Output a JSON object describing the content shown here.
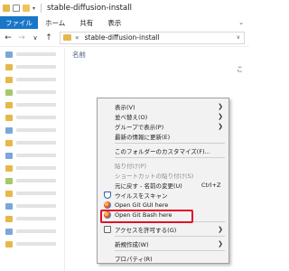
{
  "window": {
    "title": "stable-diffusion-install"
  },
  "ribbon": {
    "tabs": [
      "ファイル",
      "ホーム",
      "共有",
      "表示"
    ]
  },
  "address": {
    "overflow": "«",
    "path": "stable-diffusion-install",
    "dropdown_glyph": "∨"
  },
  "nav_buttons": {
    "back": "←",
    "forward": "→",
    "recent": "∨",
    "up": "↑"
  },
  "file_list": {
    "column_name": "名前",
    "empty_text": "こ"
  },
  "context_menu": {
    "items": [
      {
        "label": "表示(V)",
        "submenu": true
      },
      {
        "label": "並べ替え(O)",
        "submenu": true
      },
      {
        "label": "グループで表示(P)",
        "submenu": true
      },
      {
        "label": "最新の情報に更新(E)"
      },
      {
        "label": "このフォルダーのカスタマイズ(F)..."
      },
      {
        "label": "貼り付け(P)",
        "disabled": true
      },
      {
        "label": "ショートカットの貼り付け(S)",
        "disabled": true
      },
      {
        "label": "元に戻す - 名前の変更(U)",
        "accel": "Ctrl+Z"
      },
      {
        "label": "ウイルスをスキャン",
        "icon": "shield-icon"
      },
      {
        "label": "Open Git GUI here",
        "icon": "git-icon"
      },
      {
        "label": "Open Git Bash here",
        "icon": "git-icon"
      },
      {
        "label": "アクセスを許可する(G)",
        "icon": "share-icon",
        "submenu": true
      },
      {
        "label": "新規作成(W)",
        "submenu": true
      },
      {
        "label": "プロパティ(R)"
      }
    ],
    "arrow_glyph": "❯"
  },
  "colors": {
    "file_tab": "#1976c9",
    "highlight_box": "#e0102a",
    "menu_background": "#f2f2f2"
  }
}
